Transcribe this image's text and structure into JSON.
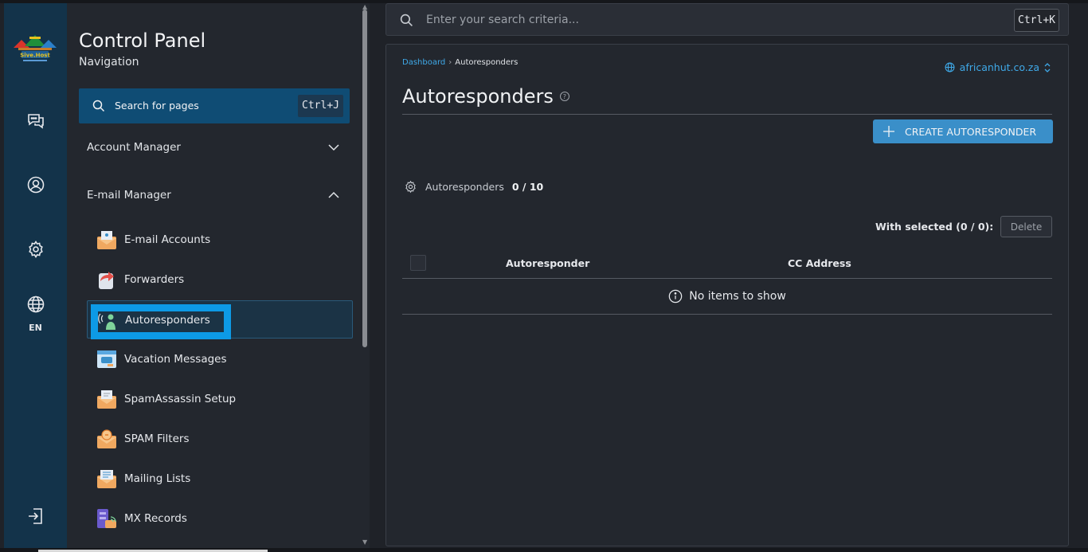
{
  "rail": {
    "logo_text": "Sive.Host",
    "language": "EN",
    "icons": [
      "chat-icon",
      "user-icon",
      "gear-icon",
      "globe-icon",
      "logout-icon"
    ]
  },
  "sidebar": {
    "title": "Control Panel",
    "subtitle": "Navigation",
    "search_label": "Search for pages",
    "search_shortcut": "Ctrl+J",
    "sections": [
      {
        "label": "Account Manager",
        "expanded": false
      },
      {
        "label": "E-mail Manager",
        "expanded": true
      }
    ],
    "items": [
      {
        "label": "E-mail Accounts"
      },
      {
        "label": "Forwarders"
      },
      {
        "label": "Autoresponders",
        "active": true
      },
      {
        "label": "Vacation Messages"
      },
      {
        "label": "SpamAssassin Setup"
      },
      {
        "label": "SPAM Filters"
      },
      {
        "label": "Mailing Lists"
      },
      {
        "label": "MX Records"
      }
    ]
  },
  "topsearch": {
    "placeholder": "Enter your search criteria...",
    "shortcut": "Ctrl+K"
  },
  "main": {
    "breadcrumb": {
      "root": "Dashboard",
      "separator": "›",
      "current": "Autoresponders"
    },
    "domain": "africanhut.co.za",
    "heading": "Autoresponders",
    "help_glyph": "?",
    "create_label": "CREATE AUTORESPONDER",
    "stat_label": "Autoresponders",
    "stat_value": "0 / 10",
    "with_selected": "With selected (0 / 0):",
    "delete_label": "Delete",
    "columns": [
      "Autoresponder",
      "CC Address"
    ],
    "empty_text": "No items to show"
  },
  "colors": {
    "accent": "#3a8fc9",
    "link": "#3fa9e8",
    "rail_bg": "#13334a",
    "highlight": "#0d9ae6"
  }
}
